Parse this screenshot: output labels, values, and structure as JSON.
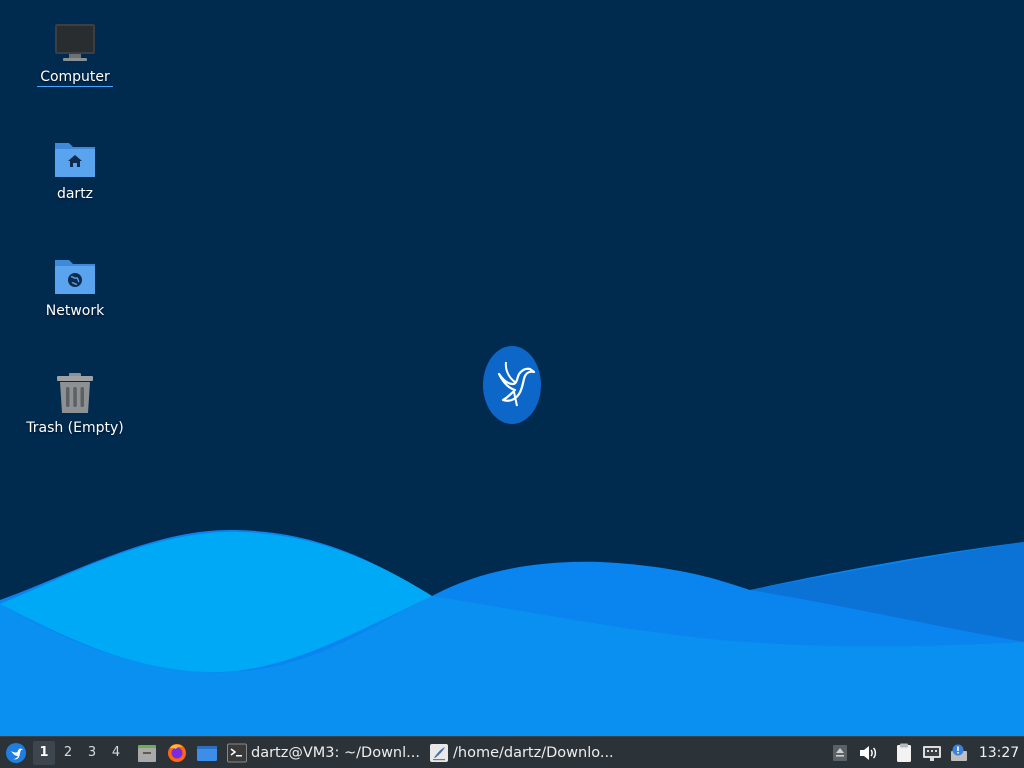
{
  "desktop": {
    "background_color": "#012a4f",
    "wave_colors": [
      "#0095e8",
      "#00aaf7",
      "#0b7fe2",
      "#0a84ee"
    ],
    "logo": "xubuntu-bird-logo",
    "icons": [
      {
        "name": "computer",
        "label": "Computer",
        "icon": "monitor-icon",
        "selected": true
      },
      {
        "name": "home",
        "label": "dartz",
        "icon": "home-folder-icon"
      },
      {
        "name": "network",
        "label": "Network",
        "icon": "network-folder-icon"
      },
      {
        "name": "trash",
        "label": "Trash (Empty)",
        "icon": "trash-icon"
      }
    ]
  },
  "taskbar": {
    "background": "#2c3338",
    "start_icon": "xubuntu-menu-icon",
    "workspaces": [
      "1",
      "2",
      "3",
      "4"
    ],
    "active_workspace": "1",
    "launchers": [
      {
        "name": "file-manager",
        "icon": "file-manager-icon"
      },
      {
        "name": "firefox",
        "icon": "firefox-icon"
      },
      {
        "name": "show-desktop",
        "icon": "show-desktop-icon"
      }
    ],
    "tasks": [
      {
        "label": "dartz@VM3: ~/Downl...",
        "icon": "terminal-icon"
      },
      {
        "label": "/home/dartz/Downlo...",
        "icon": "text-editor-icon"
      }
    ],
    "tray": [
      {
        "name": "removable-drive",
        "icon": "eject-drive-icon"
      },
      {
        "name": "volume",
        "icon": "speaker-icon"
      },
      {
        "name": "clipboard",
        "icon": "clipboard-icon"
      },
      {
        "name": "network",
        "icon": "network-wired-icon"
      },
      {
        "name": "updates",
        "icon": "update-notification-icon"
      }
    ],
    "clock": "13:27"
  }
}
